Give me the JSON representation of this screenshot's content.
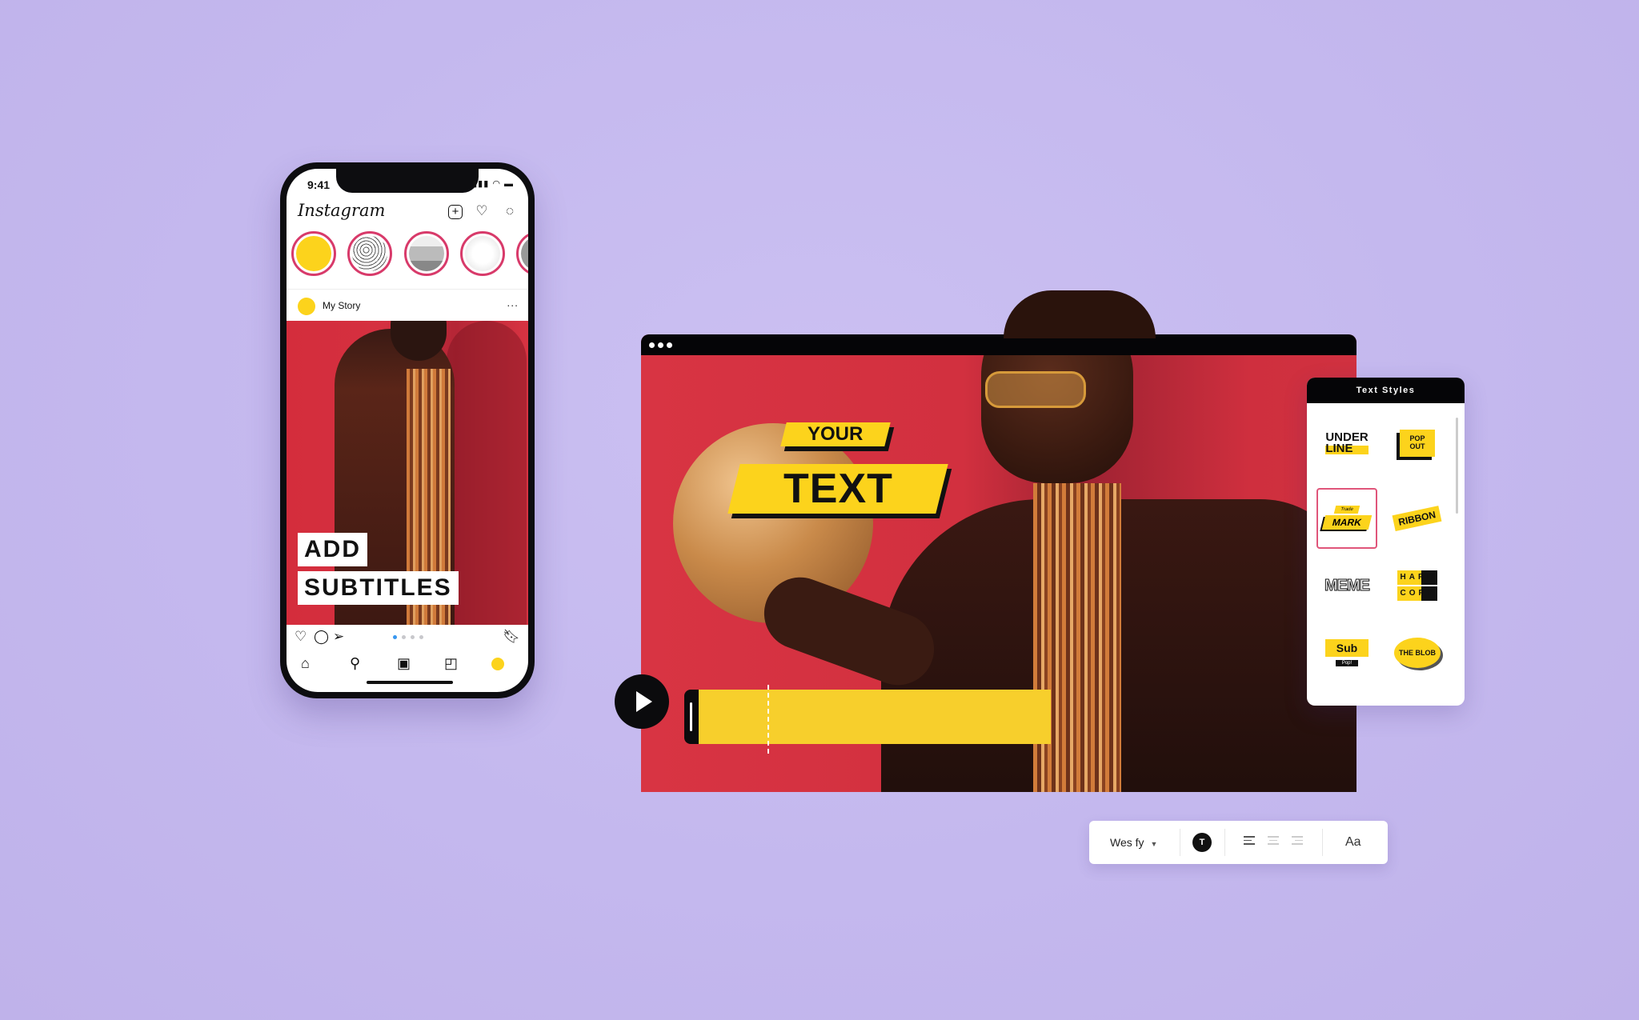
{
  "phone": {
    "status_time": "9:41",
    "app_name": "Instagram",
    "header_icons": [
      "new-post-icon",
      "heart-icon",
      "messenger-icon"
    ],
    "stories": [
      {
        "type": "own",
        "color": "#fcd31c"
      },
      {
        "type": "floral-sketch"
      },
      {
        "type": "room-photo"
      },
      {
        "type": "gallery-wall"
      },
      {
        "type": "partial"
      }
    ],
    "post": {
      "username": "My Story",
      "more": "...",
      "subtitle_lines": [
        "ADD",
        "SUBTITLES"
      ],
      "carousel_dots": 4,
      "carousel_active": 1
    },
    "nav_items": [
      "home",
      "search",
      "reels",
      "shop",
      "profile"
    ]
  },
  "editor": {
    "window_dots": 3,
    "caption_top": "YOUR",
    "caption_main": "TEXT",
    "play_label": "play"
  },
  "text_styles": {
    "title": "Text Styles",
    "items": [
      {
        "name": "underline",
        "label_lines": [
          "UNDER",
          "LINE"
        ]
      },
      {
        "name": "pop-out",
        "label_lines": [
          "POP",
          "OUT"
        ]
      },
      {
        "name": "trademark",
        "label_small": "Trade",
        "label": "MARK",
        "selected": true
      },
      {
        "name": "ribbon",
        "label": "RIBBON"
      },
      {
        "name": "meme",
        "label": "MEME"
      },
      {
        "name": "hard-copy",
        "label_lines": [
          "HARD",
          "COPY"
        ]
      },
      {
        "name": "sub-pop",
        "label": "Sub",
        "label_small": "Pop!"
      },
      {
        "name": "the-blob",
        "label": "THE BLOB"
      }
    ]
  },
  "toolbar": {
    "font": "Wes fy",
    "color_button": "T",
    "alignments": [
      "left",
      "center",
      "right"
    ],
    "active_alignment": "left",
    "case_button": "Aa"
  },
  "colors": {
    "background": "#c7bcf0",
    "accent_yellow": "#fcd31c",
    "backdrop_red": "#d2303f",
    "selected_border": "#e0557a"
  }
}
